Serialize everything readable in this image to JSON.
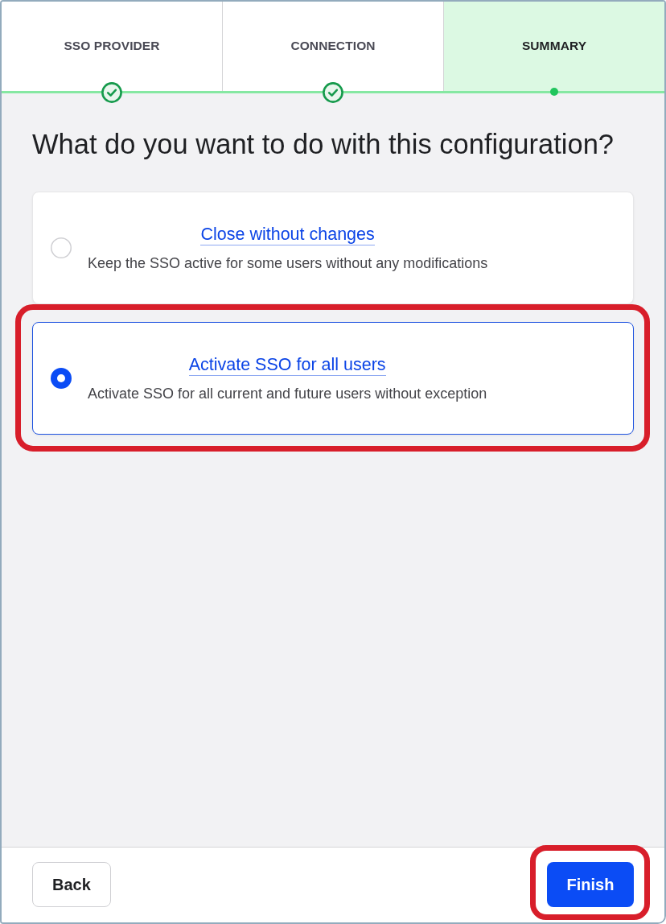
{
  "steps": [
    {
      "label": "SSO PROVIDER",
      "selected": false,
      "completed": true
    },
    {
      "label": "CONNECTION",
      "selected": false,
      "completed": true
    },
    {
      "label": "SUMMARY",
      "selected": true,
      "completed": false
    }
  ],
  "heading": "What do you want to do with this configuration?",
  "options": [
    {
      "title": "Close without changes",
      "description": "Keep the SSO active for some users without any modifications",
      "selected": false,
      "highlighted": false
    },
    {
      "title": "Activate SSO for all users",
      "description": "Activate SSO for all current and future users without exception",
      "selected": true,
      "highlighted": true
    }
  ],
  "buttons": [
    {
      "label": "Back",
      "kind": "secondary",
      "highlighted": false
    },
    {
      "label": "Finish",
      "kind": "primary",
      "highlighted": true
    }
  ]
}
